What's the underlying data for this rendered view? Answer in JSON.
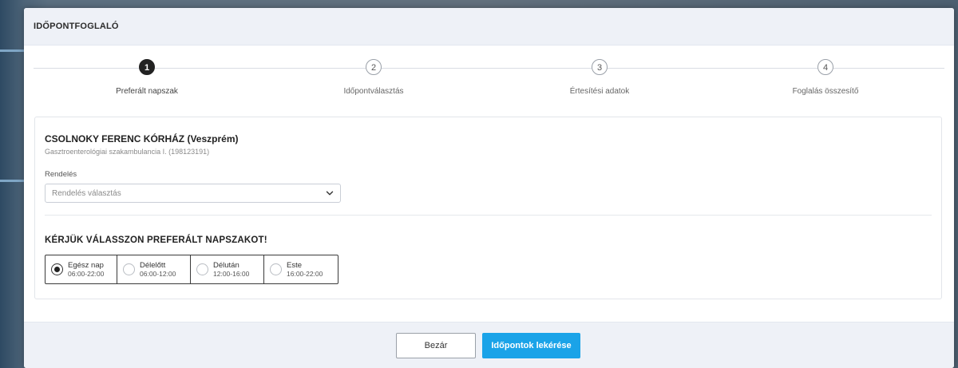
{
  "modal": {
    "title": "IDŐPONTFOGLALÓ"
  },
  "steps": [
    {
      "number": "1",
      "label": "Preferált napszak",
      "active": true
    },
    {
      "number": "2",
      "label": "Időpontválasztás",
      "active": false
    },
    {
      "number": "3",
      "label": "Értesítési adatok",
      "active": false
    },
    {
      "number": "4",
      "label": "Foglalás összesítő",
      "active": false
    }
  ],
  "hospital": {
    "name": "CSOLNOKY FERENC KÓRHÁZ (Veszprém)",
    "department": "Gasztroenterológiai szakambulancia I. (198123191)"
  },
  "rendeles": {
    "label": "Rendelés",
    "placeholder": "Rendelés választás"
  },
  "daypart": {
    "title": "KÉRJÜK VÁLASSZON PREFERÁLT NAPSZAKOT!",
    "options": [
      {
        "name": "Egész nap",
        "time": "06:00-22:00",
        "selected": true
      },
      {
        "name": "Délelőtt",
        "time": "06:00-12:00",
        "selected": false
      },
      {
        "name": "Délután",
        "time": "12:00-16:00",
        "selected": false
      },
      {
        "name": "Este",
        "time": "16:00-22:00",
        "selected": false
      }
    ]
  },
  "footer": {
    "close_label": "Bezár",
    "submit_label": "Időpontok lekérése"
  },
  "colors": {
    "primary": "#1aa3e8",
    "header_bg": "#eef1f7",
    "active_step": "#222222"
  },
  "icons": {
    "select_arrow": "chevron-down-icon",
    "radio_selected": "radio-selected-icon",
    "radio_unselected": "radio-unselected-icon"
  }
}
